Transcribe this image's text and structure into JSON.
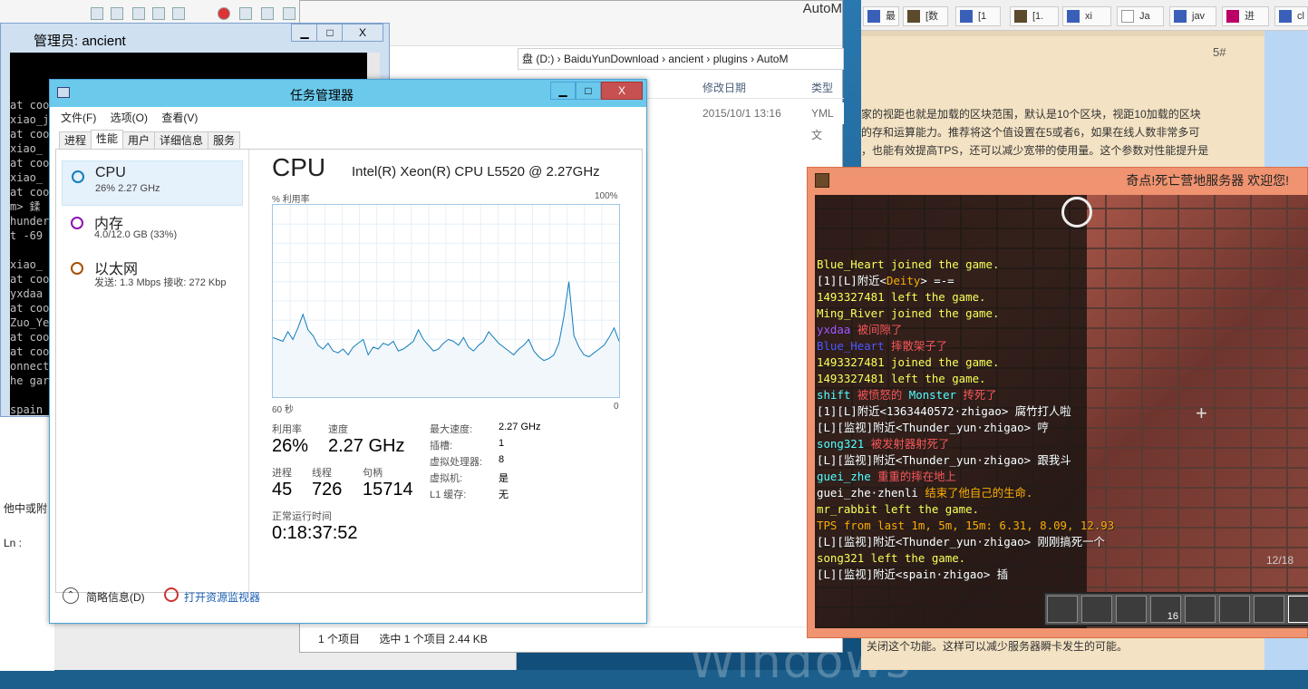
{
  "console": {
    "title": "管理员: ancient",
    "lines": [
      "at coords 11,-420,3,-148",
      "xiao_j triggered interact ScriptBlock...",
      "at coo",
      "xiao_",
      "at coo",
      "xiao_",
      "at coo",
      "m> 鍒",
      "hunder",
      "t -69",
      "",
      "xiao_",
      "at coo",
      "yxdaa",
      "at coo",
      "Zuo_Ye",
      "at coo",
      "at coo",
      "onnect",
      "he gar",
      "",
      "spain"
    ],
    "minimize": "▁",
    "maximize": "□",
    "close": "X"
  },
  "editor": {
    "side_text": "他中或附",
    "ln_label": "Ln :"
  },
  "explorer": {
    "title": "AutoM",
    "address": "盘 (D:)  ›  BaiduYunDownload  ›  ancient  ›  plugins  ›  AutoM",
    "col_date": "修改日期",
    "col_type": "类型",
    "row_date": "2015/10/1 13:16",
    "row_type": "YML 文",
    "status_count": "1 个项目",
    "status_selected": "选中 1 个项目  2.44 KB"
  },
  "taskmgr": {
    "title": "任务管理器",
    "menu": [
      "文件(F)",
      "选项(O)",
      "查看(V)"
    ],
    "tabs": [
      "进程",
      "性能",
      "用户",
      "详细信息",
      "服务"
    ],
    "resources": [
      {
        "name": "CPU",
        "sub": "26%  2.27 GHz",
        "color": "#117dbb"
      },
      {
        "name": "内存",
        "sub": "4.0/12.0 GB (33%)",
        "color": "#8b12ae"
      },
      {
        "name": "以太网",
        "sub": "发送: 1.3 Mbps 接收: 272 Kbp",
        "color": "#a74f01"
      }
    ],
    "cpu_heading": "CPU",
    "cpu_model": "Intel(R) Xeon(R) CPU L5520 @ 2.27GHz",
    "graph_label": "% 利用率",
    "graph_max": "100%",
    "graph_time": "60 秒",
    "graph_zero": "0",
    "utilization_label": "利用率",
    "utilization_value": "26%",
    "speed_label": "速度",
    "speed_value": "2.27 GHz",
    "processes_label": "进程",
    "processes_value": "45",
    "threads_label": "线程",
    "threads_value": "726",
    "handles_label": "句柄",
    "handles_value": "15714",
    "uptime_label": "正常运行时间",
    "uptime_value": "0:18:37:52",
    "specs": [
      {
        "k": "最大速度:",
        "v": "2.27 GHz"
      },
      {
        "k": "插槽:",
        "v": "1"
      },
      {
        "k": "虚拟处理器:",
        "v": "8"
      },
      {
        "k": "虚拟机:",
        "v": "是"
      },
      {
        "k": "L1 缓存:",
        "v": "无"
      }
    ],
    "fewer_details": "简略信息(D)",
    "open_monitor": "打开资源监视器",
    "minimize": "▁",
    "maximize": "□",
    "close": "X"
  },
  "cpu_history": [
    31,
    30,
    29,
    34,
    30,
    36,
    43,
    35,
    32,
    27,
    25,
    28,
    24,
    23,
    25,
    22,
    26,
    28,
    30,
    22,
    26,
    25,
    28,
    27,
    29,
    24,
    25,
    27,
    29,
    35,
    30,
    27,
    24,
    25,
    28,
    30,
    29,
    27,
    31,
    26,
    24,
    27,
    29,
    34,
    31,
    28,
    26,
    24,
    22,
    25,
    27,
    30,
    24,
    21,
    19,
    20,
    22,
    28,
    42,
    60,
    32,
    26,
    22,
    21,
    23,
    25,
    27,
    31,
    36,
    29
  ],
  "doc": {
    "tabs": [
      "最",
      "[数",
      "[1",
      "[1.",
      "xi",
      "Ja",
      "jav",
      "进",
      "cl"
    ],
    "page_number": "5#",
    "lines": [
      "家的视距也就是加载的区块范围，默认是10个区块，视距10加载的区块",
      "的存和运算能力。推荐将这个值设置在5或者6，如果在线人数非常多可",
      "，也能有效提高TPS，还可以减少宽带的使用量。这个参数对性能提升是"
    ],
    "bottom_line": "关闭这个功能。这样可以减少服务器瞬卡发生的可能。"
  },
  "minecraft": {
    "title": "奇点!死亡营地服务器 欢迎您!",
    "chat": [
      [
        {
          "t": "Blue_Heart joined the game.",
          "c": "yel"
        }
      ],
      [
        {
          "t": "[1][L]附近<",
          "c": "wht"
        },
        {
          "t": "Deity",
          "c": "gld"
        },
        {
          "t": "> =-=",
          "c": "wht"
        }
      ],
      [
        {
          "t": "1493327481 left the game.",
          "c": "yel"
        }
      ],
      [
        {
          "t": "Ming_River joined the game.",
          "c": "yel"
        }
      ],
      [
        {
          "t": "yxdaa ",
          "c": "pur"
        },
        {
          "t": "被间隙了",
          "c": "red"
        }
      ],
      [
        {
          "t": "Blue_Heart ",
          "c": "blu"
        },
        {
          "t": "摔散架子了",
          "c": "red"
        }
      ],
      [
        {
          "t": "1493327481 joined the game.",
          "c": "yel"
        }
      ],
      [
        {
          "t": "1493327481 left the game.",
          "c": "yel"
        }
      ],
      [
        {
          "t": "shift ",
          "c": "aqu"
        },
        {
          "t": "被愤怒的 ",
          "c": "red"
        },
        {
          "t": "Monster",
          "c": "aqu"
        },
        {
          "t": " 抟死了",
          "c": "red"
        }
      ],
      [
        {
          "t": "[1][L]附近<1363440572·zhigao> 腐竹打人啦",
          "c": "wht"
        }
      ],
      [
        {
          "t": "[L][监视]附近<Thunder_yun·zhigao> 哼",
          "c": "wht"
        }
      ],
      [
        {
          "t": "song321 ",
          "c": "aqu"
        },
        {
          "t": "被发射器射死了",
          "c": "red"
        }
      ],
      [
        {
          "t": "[L][监视]附近<Thunder_yun·zhigao> 跟我斗",
          "c": "wht"
        }
      ],
      [
        {
          "t": "guei_zhe ",
          "c": "aqu"
        },
        {
          "t": "重重的摔在地上",
          "c": "red"
        }
      ],
      [
        {
          "t": "guei_zhe·zhenli ",
          "c": "wht"
        },
        {
          "t": "结束了他自己的生命.",
          "c": "gld"
        }
      ],
      [
        {
          "t": "mr_rabbit left the game.",
          "c": "yel"
        }
      ],
      [
        {
          "t": "TPS from last 1m, 5m, 15m: 6.31, 8.09, 12.93",
          "c": "gld"
        }
      ],
      [
        {
          "t": "[L][监视]附近<Thunder_yun·zhigao> 刚刚搞死一个",
          "c": "wht"
        }
      ],
      [
        {
          "t": "song321 left the game.",
          "c": "yel"
        }
      ],
      [
        {
          "t": "[L][监视]附近<spain·zhigao> 插",
          "c": "wht"
        }
      ]
    ],
    "armor": "12/18",
    "stack": "16"
  }
}
